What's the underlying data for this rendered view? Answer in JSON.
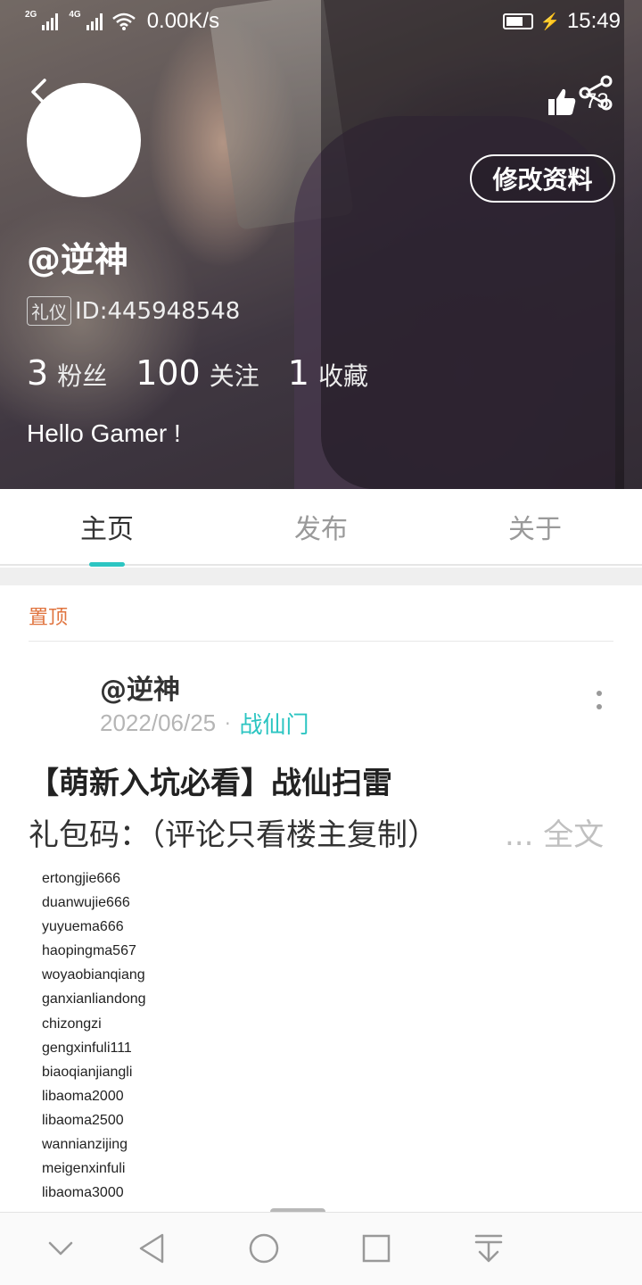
{
  "status_bar": {
    "net1": "2G",
    "net2": "4G",
    "speed": "0.00K/s",
    "time": "15:49"
  },
  "profile": {
    "edit_label": "修改资料",
    "like_count": "73",
    "username": "@逆神",
    "badge": "礼仪",
    "id_text": "ID:445948548",
    "stats": [
      {
        "num": "3",
        "label": "粉丝"
      },
      {
        "num": "100",
        "label": "关注"
      },
      {
        "num": "1",
        "label": "收藏"
      }
    ],
    "bio": "Hello Gamer !"
  },
  "tabs": [
    {
      "label": "主页",
      "active": true
    },
    {
      "label": "发布",
      "active": false
    },
    {
      "label": "关于",
      "active": false
    }
  ],
  "pinned_label": "置顶",
  "post": {
    "author": "@逆神",
    "date": "2022/06/25",
    "separator": "·",
    "circle": "战仙门",
    "title": "【萌新入坑必看】战仙扫雷",
    "snippet": "礼包码：（评论只看楼主复制）",
    "more": "... 全文",
    "codes": [
      "ertongjie666",
      "duanwujie666",
      "yuyuema666",
      "haopingma567",
      "woyaobianqiang",
      "ganxianliandong",
      "chizongzi",
      "gengxinfuli111",
      "biaoqianjiangli",
      "libaoma2000",
      "libaoma2500",
      "wannianzijing",
      "meigenxinfuli",
      "libaoma3000"
    ]
  },
  "icons": {
    "back": "back-arrow-icon",
    "like": "thumbs-up-icon",
    "share": "share-icon",
    "more": "more-vertical-icon",
    "nav": [
      "collapse-chevron-icon",
      "nav-back-icon",
      "nav-home-icon",
      "nav-recents-icon",
      "nav-download-icon"
    ]
  },
  "colors": {
    "accent": "#2cc5c2",
    "pinned": "#e0743f"
  }
}
